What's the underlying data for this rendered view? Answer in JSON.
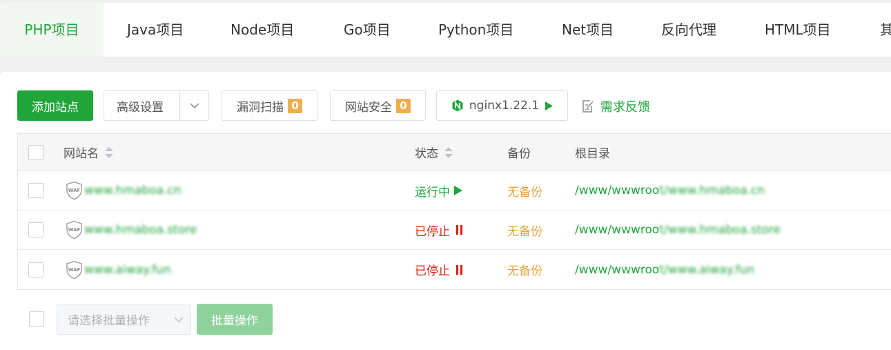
{
  "tabs": [
    {
      "label": "PHP项目",
      "active": true
    },
    {
      "label": "Java项目"
    },
    {
      "label": "Node项目"
    },
    {
      "label": "Go项目"
    },
    {
      "label": "Python项目"
    },
    {
      "label": "Net项目"
    },
    {
      "label": "反向代理"
    },
    {
      "label": "HTML项目"
    },
    {
      "label": "其"
    }
  ],
  "toolbar": {
    "add_site": "添加站点",
    "advanced": "高级设置",
    "vuln_scan": "漏洞扫描",
    "vuln_count": "0",
    "site_security": "网站安全",
    "security_count": "0",
    "nginx": "nginx1.22.1",
    "feedback": "需求反馈"
  },
  "table": {
    "headers": {
      "name": "网站名",
      "status": "状态",
      "backup": "备份",
      "root": "根目录"
    },
    "rows": [
      {
        "name": "www.hmaboa.cn",
        "status": "运行中",
        "backup": "无备份",
        "root_prefix": "/www/wwwroo",
        "root_suffix": "t/www.hmaboa.cn"
      },
      {
        "name": "www.hmaboa.store",
        "status": "已停止",
        "backup": "无备份",
        "root_prefix": "/www/wwwroo",
        "root_suffix": "t/www.hmaboa.store"
      },
      {
        "name": "www.aiway.fun",
        "status": "已停止",
        "backup": "无备份",
        "root_prefix": "/www/wwwroo",
        "root_suffix": "t/www.aiway.fun"
      }
    ]
  },
  "bulk": {
    "placeholder": "请选择批量操作",
    "button": "批量操作"
  },
  "colors": {
    "accent": "#20a53a",
    "stopped": "#d9200f",
    "warning": "#e6a23c",
    "badge": "#f0ad4e"
  },
  "icons": [
    "waf-shield-icon",
    "nginx-icon",
    "play-icon",
    "pause-icon",
    "feedback-edit-icon",
    "chevron-down-icon",
    "sort-icon"
  ]
}
